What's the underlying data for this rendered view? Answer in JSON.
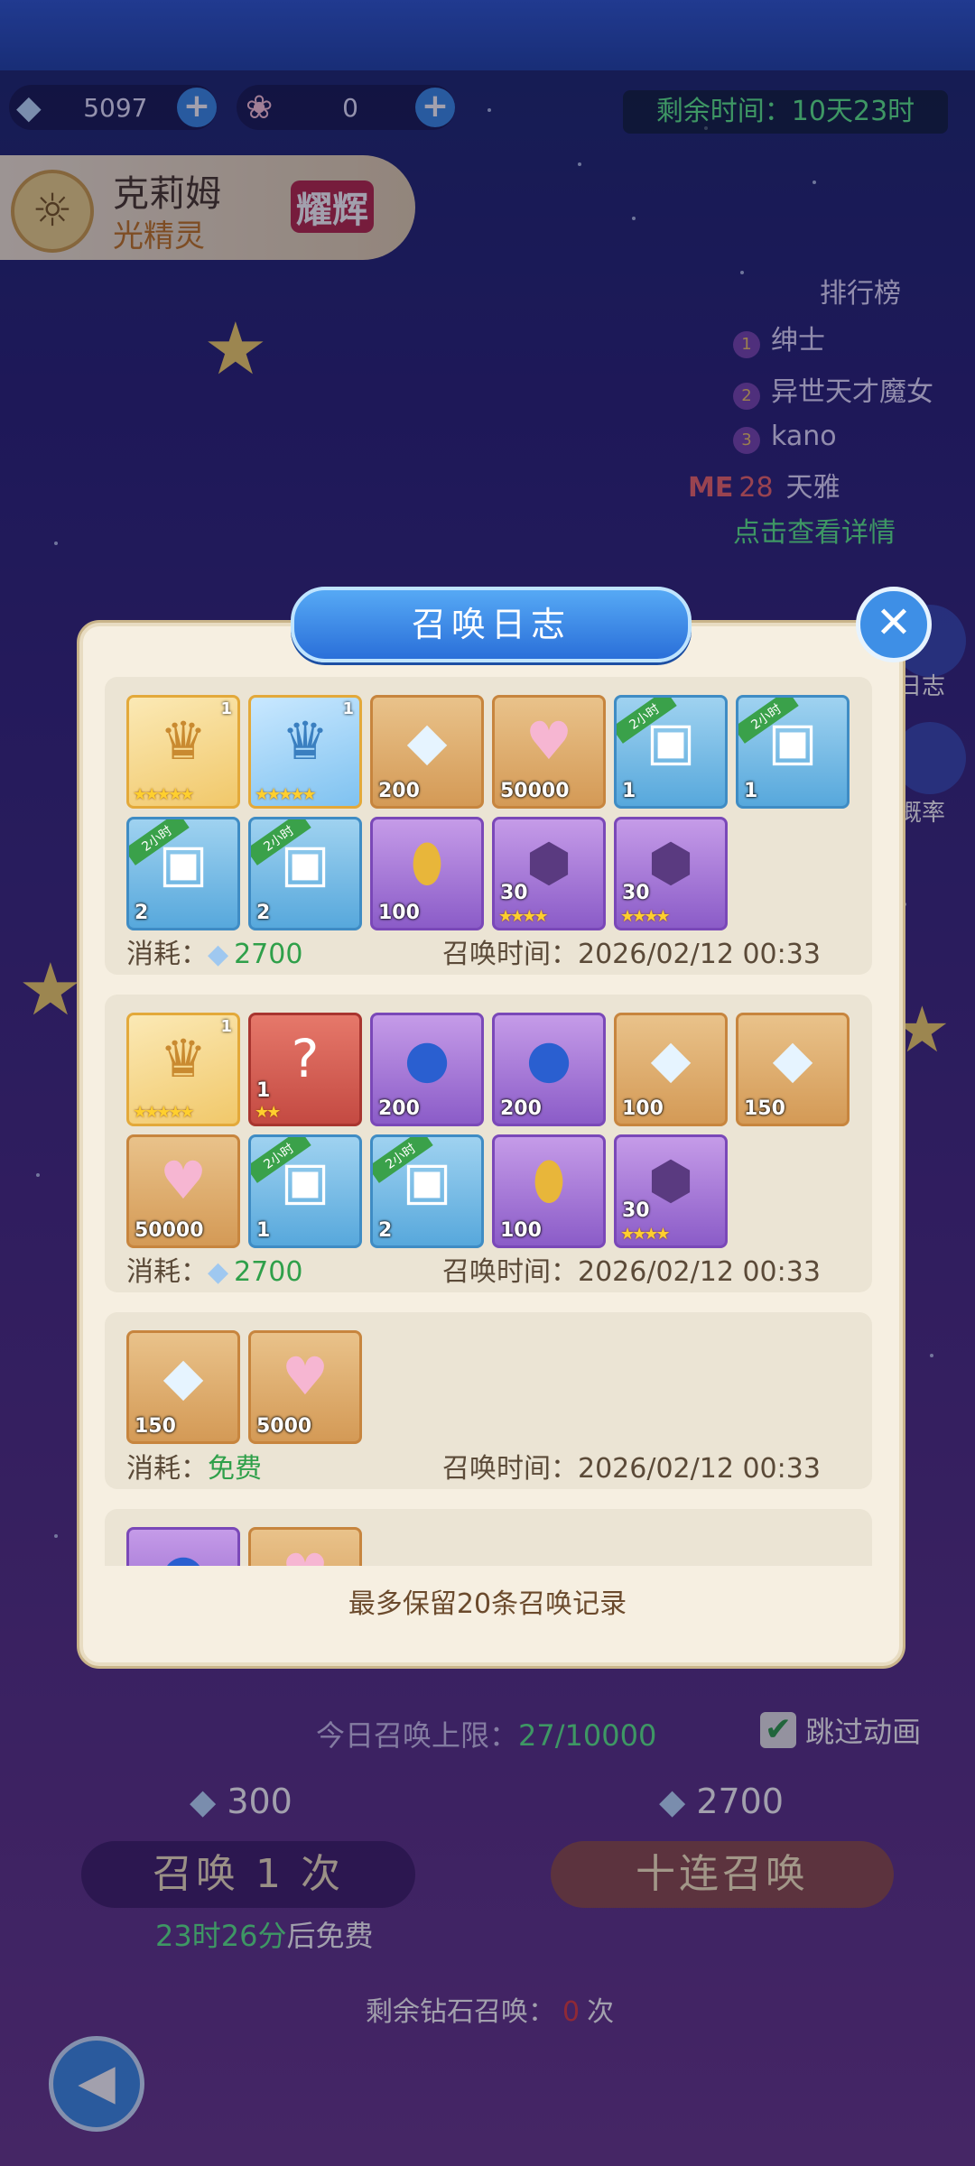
{
  "top": {
    "diamond_count": "5097",
    "flower_count": "0",
    "remaining_time": "剩余时间：10天23时"
  },
  "hero": {
    "name": "克莉姆",
    "element": "光精灵",
    "badge": "耀辉"
  },
  "ranking": {
    "title": "排行榜",
    "entries": [
      {
        "rank": "1",
        "name": "绅士"
      },
      {
        "rank": "2",
        "name": "异世天才魔女"
      },
      {
        "rank": "3",
        "name": "kano"
      }
    ],
    "me_label": "ME",
    "me_rank": "28",
    "me_name": "天雅",
    "detail_link": "点击查看详情"
  },
  "side": {
    "log": "日志",
    "rate": "概率"
  },
  "bottom": {
    "daily_limit": "今日召唤上限：",
    "daily_limit_value": "27/10000",
    "skip_anim": "跳过动画",
    "cost_single": "300",
    "cost_ten": "2700",
    "summon_once": "召唤 1 次",
    "summon_ten": "十连召唤",
    "free_timer": "23时26分",
    "free_suffix": "后免费",
    "remaining_diamond": "剩余钻石召唤：",
    "remaining_diamond_value": "0",
    "remaining_suffix": "次"
  },
  "dialog": {
    "title": "召唤日志",
    "cost_label": "消耗：",
    "time_label": "召唤时间：",
    "note": "最多保留20条召唤记录",
    "records": [
      {
        "cost": "2700",
        "time": "2026/02/12 00:33",
        "items": [
          {
            "kind": "hero",
            "qty": "1",
            "stars": "★★★★★"
          },
          {
            "kind": "hero2",
            "qty": "1",
            "stars": "★★★★★"
          },
          {
            "kind": "gem",
            "qty": "200"
          },
          {
            "kind": "exp",
            "qty": "50000"
          },
          {
            "kind": "chest",
            "qty": "1",
            "tag": "2小时"
          },
          {
            "kind": "chest",
            "qty": "1",
            "tag": "2小时"
          },
          {
            "kind": "chest",
            "qty": "2",
            "tag": "2小时"
          },
          {
            "kind": "chest",
            "qty": "2",
            "tag": "2小时"
          },
          {
            "kind": "egg",
            "qty": "100"
          },
          {
            "kind": "shard",
            "qty": "30",
            "stars": "★★★★"
          },
          {
            "kind": "shard",
            "qty": "30",
            "stars": "★★★★"
          }
        ]
      },
      {
        "cost": "2700",
        "time": "2026/02/12 00:33",
        "items": [
          {
            "kind": "hero",
            "qty": "1",
            "stars": "★★★★★"
          },
          {
            "kind": "box",
            "qty": "1",
            "stars": "★★"
          },
          {
            "kind": "orb",
            "qty": "200"
          },
          {
            "kind": "orb",
            "qty": "200"
          },
          {
            "kind": "gem",
            "qty": "100"
          },
          {
            "kind": "gem",
            "qty": "150"
          },
          {
            "kind": "exp",
            "qty": "50000"
          },
          {
            "kind": "chest",
            "qty": "1",
            "tag": "2小时"
          },
          {
            "kind": "chest",
            "qty": "2",
            "tag": "2小时"
          },
          {
            "kind": "egg",
            "qty": "100"
          },
          {
            "kind": "shard",
            "qty": "30",
            "stars": "★★★★"
          }
        ]
      },
      {
        "cost": "免费",
        "time": "2026/02/12 00:33",
        "items": [
          {
            "kind": "gem",
            "qty": "150"
          },
          {
            "kind": "exp",
            "qty": "5000"
          }
        ]
      }
    ]
  }
}
